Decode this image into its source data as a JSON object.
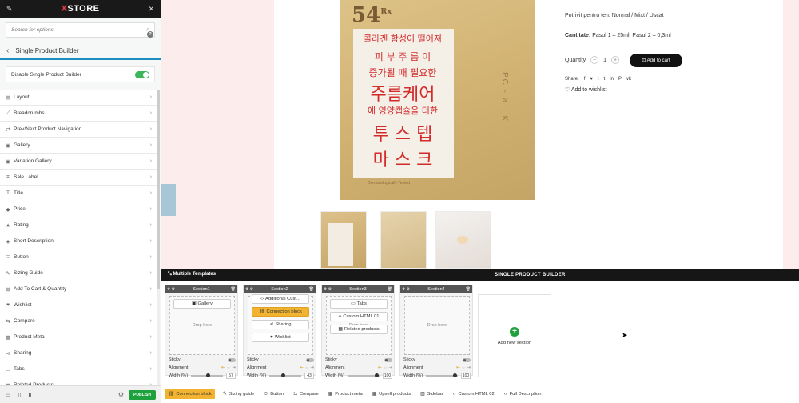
{
  "panel": {
    "brand_prefix": "X",
    "brand": "STORE",
    "pin_icon": "pin-icon",
    "close_icon": "close-icon",
    "search_placeholder": "Search for options",
    "section_title": "Single Product Builder",
    "help": "?",
    "disable_label": "Disable Single Product Builder",
    "disable_enabled": true,
    "items": [
      {
        "label": "Layout",
        "icon": "layout-icon",
        "glyph": "▤"
      },
      {
        "label": "Breadcrumbs",
        "icon": "breadcrumbs-icon",
        "glyph": "⟋"
      },
      {
        "label": "Prev/Next Product Navigation",
        "icon": "arrows-icon",
        "glyph": "⇄"
      },
      {
        "label": "Gallery",
        "icon": "gallery-icon",
        "glyph": "▣"
      },
      {
        "label": "Variation Gallery",
        "icon": "variation-gallery-icon",
        "glyph": "▣"
      },
      {
        "label": "Sale Label",
        "icon": "sale-label-icon",
        "glyph": "⌗"
      },
      {
        "label": "Title",
        "icon": "title-icon",
        "glyph": "T"
      },
      {
        "label": "Price",
        "icon": "price-tag-icon",
        "glyph": "◆"
      },
      {
        "label": "Rating",
        "icon": "star-icon",
        "glyph": "★"
      },
      {
        "label": "Short Description",
        "icon": "description-icon",
        "glyph": "◈"
      },
      {
        "label": "Button",
        "icon": "button-icon",
        "glyph": "⬭"
      },
      {
        "label": "Sizing Guide",
        "icon": "ruler-icon",
        "glyph": "✎"
      },
      {
        "label": "Add To Cart & Quantity",
        "icon": "cart-icon",
        "glyph": "⊞"
      },
      {
        "label": "Wishlist",
        "icon": "heart-icon",
        "glyph": "♥"
      },
      {
        "label": "Compare",
        "icon": "compare-icon",
        "glyph": "⇆"
      },
      {
        "label": "Product Meta",
        "icon": "product-meta-icon",
        "glyph": "▦"
      },
      {
        "label": "Sharing",
        "icon": "share-icon",
        "glyph": "⋖"
      },
      {
        "label": "Tabs",
        "icon": "tabs-icon",
        "glyph": "▭"
      },
      {
        "label": "Related Products",
        "icon": "related-products-icon",
        "glyph": "▦"
      }
    ],
    "publish_label": "PUBLISH"
  },
  "product": {
    "image_number": "54",
    "image_sup": "Rx",
    "korean_lines": [
      "콜라겐 함성이 떨어져",
      "피 부  주 름 이",
      "증가될 때 필요한",
      "주름케어",
      "에 영양캡슐을 더한",
      "투 스 텝",
      "마 스 크"
    ],
    "side_text": "PC - a . K",
    "small_text": "Dermatologically Tested",
    "skin_type": "Potrivit pentru ten: Normal / Mixt / Uscat",
    "quantity_label": "Cantitate:",
    "quantity_value": "Pasul 1 – 25ml, Pasul 2 – 0,3ml",
    "qty_label": "Quantity",
    "qty_minus": "−",
    "qty_value": "1",
    "qty_plus": "+",
    "add_to_cart": "Add to cart",
    "share_label": "Share:",
    "share_icons": [
      "f",
      "♥",
      "t",
      "t",
      "in",
      "P",
      "vk"
    ],
    "wishlist": "Add to wishlist"
  },
  "builder": {
    "multiple_templates": "Multiple Templates",
    "header": "SINGLE PRODUCT BUILDER",
    "sections": [
      {
        "name": "Section1",
        "blocks": [
          "Gallery"
        ],
        "drop_here": "Drop here",
        "width": "57",
        "width_fraction": 0.57
      },
      {
        "name": "Section2",
        "blocks": [
          "Additional Cust...",
          "Connection block",
          "Sharing",
          "Wishlist"
        ],
        "drop_here": "",
        "width": "43",
        "width_fraction": 0.43
      },
      {
        "name": "Section3",
        "blocks": [
          "Tabs",
          "Custom HTML 01",
          "Related products"
        ],
        "drop_here": "Drop here",
        "width": "100",
        "width_fraction": 1.0
      },
      {
        "name": "Section4",
        "blocks": [],
        "drop_here": "Drop here",
        "width": "100",
        "width_fraction": 1.0
      }
    ],
    "sticky_label": "Sticky",
    "alignment_label": "Alignment",
    "width_label": "Width (%)",
    "add_section": "Add new section",
    "elements": [
      {
        "label": "Connection block",
        "active": true
      },
      {
        "label": "Sizing guide",
        "active": false
      },
      {
        "label": "Button",
        "active": false
      },
      {
        "label": "Compare",
        "active": false
      },
      {
        "label": "Product meta",
        "active": false
      },
      {
        "label": "Upsell products",
        "active": false
      },
      {
        "label": "Sidebar",
        "active": false
      },
      {
        "label": "Custom HTML 02",
        "active": false
      },
      {
        "label": "Full Description",
        "active": false
      }
    ]
  },
  "colors": {
    "accent_green": "#1ea03c",
    "active_block": "#f2b330",
    "brand_red": "#e93d3d",
    "preview_bg": "#fdecec"
  }
}
